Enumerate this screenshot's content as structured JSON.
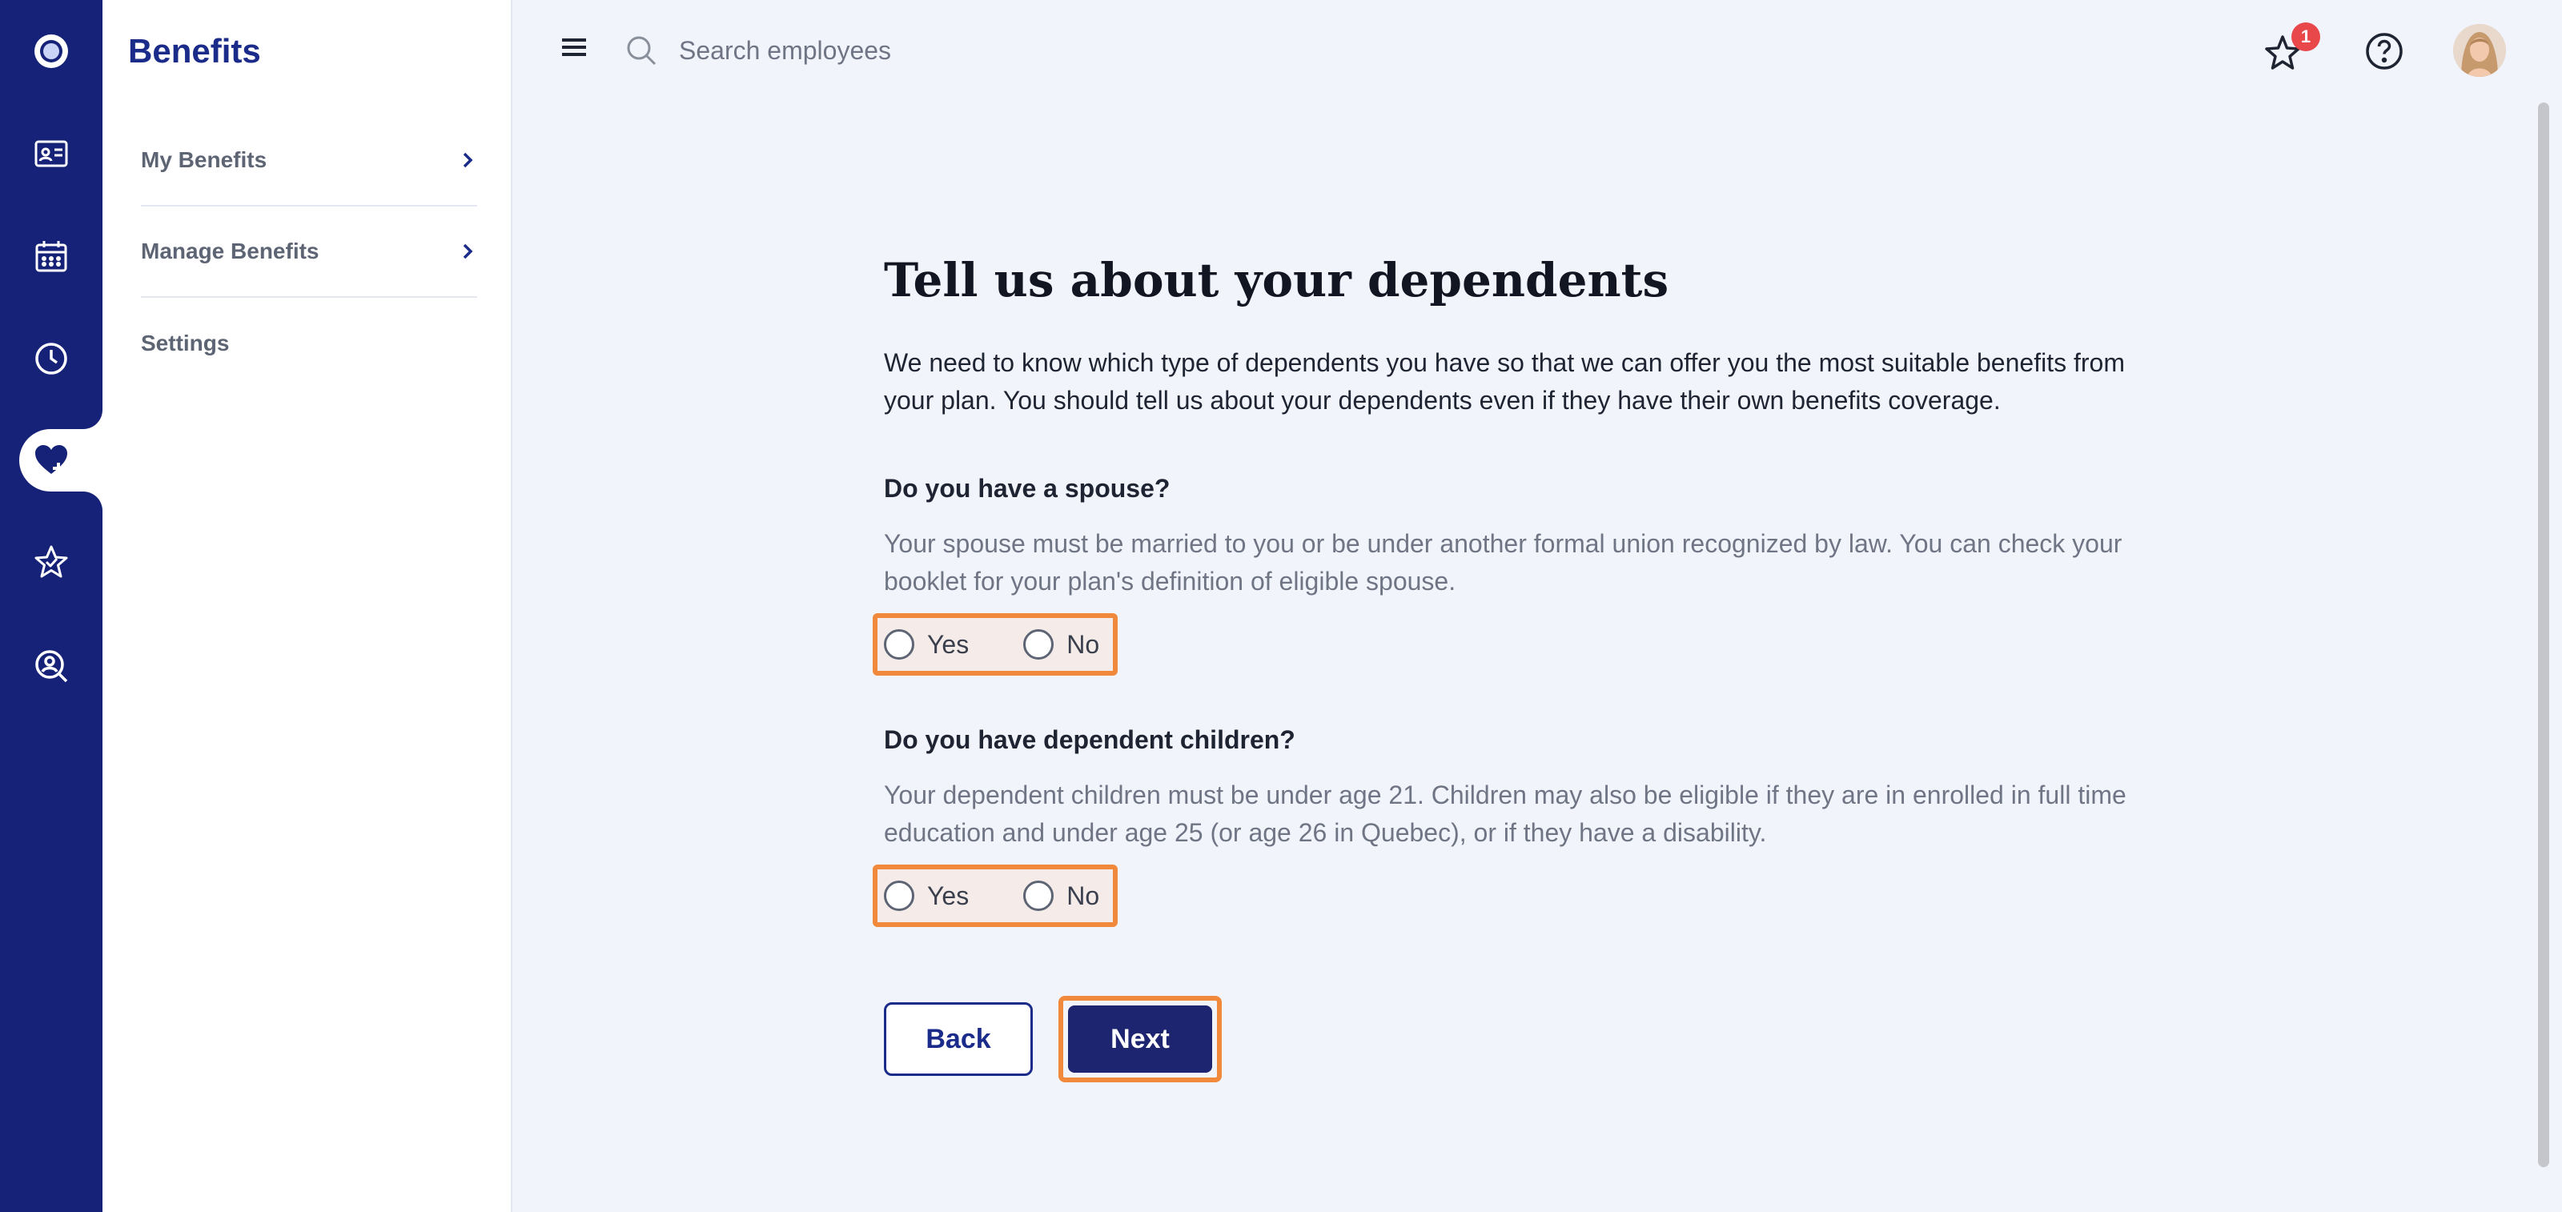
{
  "nav_rail": {
    "items": [
      {
        "icon": "logo-icon"
      },
      {
        "icon": "id-card-icon"
      },
      {
        "icon": "calendar-icon"
      },
      {
        "icon": "clock-icon"
      },
      {
        "icon": "heart-plus-icon",
        "active": true
      },
      {
        "icon": "star-icon"
      },
      {
        "icon": "search-person-icon"
      }
    ],
    "color": "#162277"
  },
  "sidebar": {
    "title": "Benefits",
    "items": [
      {
        "label": "My Benefits",
        "has_chevron": true
      },
      {
        "label": "Manage Benefits",
        "has_chevron": true
      },
      {
        "label": "Settings",
        "has_chevron": false
      }
    ]
  },
  "topbar": {
    "search_placeholder": "Search employees",
    "notification_count": "1"
  },
  "main": {
    "title": "Tell us about your dependents",
    "intro": "We need to know which type of dependents you have so that we can offer you the most suitable benefits from your plan. You should tell us about your dependents even if they have their own benefits coverage.",
    "spouse": {
      "question": "Do you have a spouse?",
      "helper": "Your spouse must be married to you or be under another formal union recognized by law. You can check your booklet for your plan's definition of eligible spouse.",
      "yes_label": "Yes",
      "no_label": "No"
    },
    "children": {
      "question": "Do you have dependent children?",
      "helper": "Your dependent children must be under age 21. Children may also be eligible if they are in enrolled in full time education and under age 25 (or age 26 in Quebec), or if they have a disability.",
      "yes_label": "Yes",
      "no_label": "No"
    },
    "back_label": "Back",
    "next_label": "Next"
  },
  "colors": {
    "brand": "#162277",
    "highlight": "#f0893c",
    "badge": "#e8484a",
    "page_bg": "#f1f4fb"
  }
}
